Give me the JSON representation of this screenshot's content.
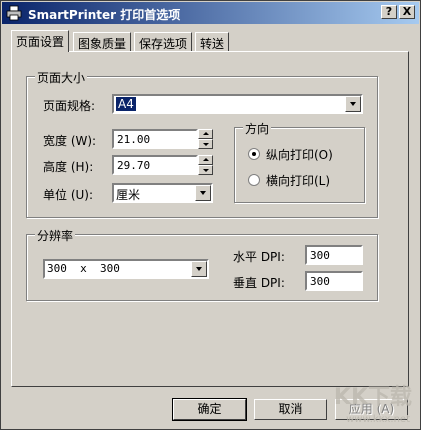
{
  "window": {
    "title": "SmartPrinter 打印首选项",
    "help_btn": "?",
    "close_btn": "X"
  },
  "tabs": [
    "页面设置",
    "图象质量",
    "保存选项",
    "转送"
  ],
  "page_size": {
    "group_label": "页面大小",
    "spec_label": "页面规格:",
    "spec_value": "A4",
    "width_label": "宽度 (W):",
    "width_value": "21.00",
    "height_label": "高度 (H):",
    "height_value": "29.70",
    "unit_label": "单位 (U):",
    "unit_value": "厘米"
  },
  "orientation": {
    "group_label": "方向",
    "portrait": "纵向打印(O)",
    "landscape": "横向打印(L)",
    "selected": "portrait"
  },
  "resolution": {
    "group_label": "分辨率",
    "select_value": "300  x  300",
    "h_label": "水平 DPI:",
    "h_value": "300",
    "v_label": "垂直 DPI:",
    "v_value": "300"
  },
  "buttons": {
    "ok": "确定",
    "cancel": "取消",
    "apply": "应用 (A)"
  },
  "watermark": {
    "text": "KK下载",
    "url": "www.kkx.net"
  }
}
